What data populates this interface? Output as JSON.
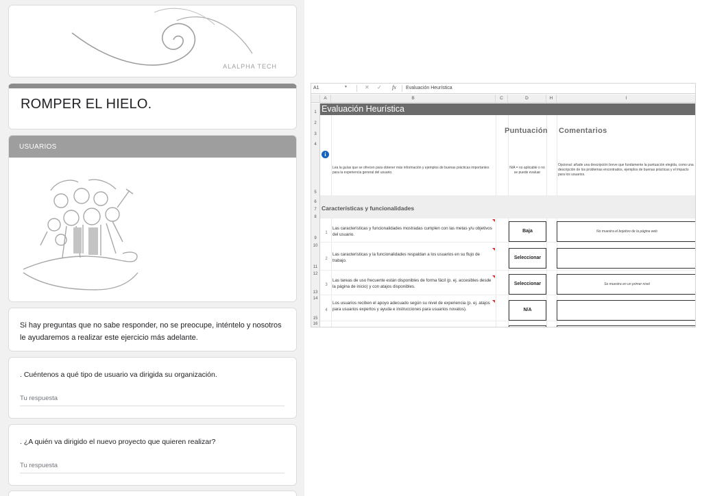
{
  "form": {
    "logo_text": "ALALPHA TECH",
    "title": "ROMPER EL HIELO.",
    "section_title": "USUARIOS",
    "note": "Si hay preguntas que no sabe responder, no se preocupe, inténtelo y nosotros le ayudaremos a realizar este ejercicio más adelante.",
    "questions": [
      {
        "text": ". Cuéntenos a qué tipo de usuario va dirigida su organización.",
        "placeholder": "Tu respuesta"
      },
      {
        "text": ". ¿A quién va dirigido el nuevo proyecto que quieren realizar?",
        "placeholder": "Tu respuesta"
      }
    ]
  },
  "sheet": {
    "name_box": "A1",
    "formula_value": "Evaluación Heurística",
    "fx_label": "fx",
    "columns": [
      "A",
      "B",
      "C",
      "D",
      "H",
      "I"
    ],
    "rows": [
      "1",
      "2",
      "3",
      "4",
      "5",
      "6",
      "7",
      "8",
      "9",
      "10",
      "11",
      "12",
      "13",
      "14",
      "15",
      "16"
    ],
    "title": "Evaluación Heurística",
    "header_score": "Puntuación",
    "header_comments": "Comentarios",
    "instructions": {
      "b": "Lea la guías que se ofrecen para obtener más información y ejemplos de buenas prácticas importantes para la experiencia general del usuario.",
      "d": "N/A = no aplicable o no se puede evaluar",
      "i": "Opcional: añade una descripción breve que fundamente la puntuación elegida, como una descripción de los problemas encontrados, ejemplos de buenas prácticas y el impacto para los usuarios."
    },
    "section": "Características y funcionalidades",
    "criteria": [
      {
        "num": "1",
        "text": "Las características y funcionalidades mostradas cumplen con las metas y/u objetivos del usuario.",
        "score": "Baja",
        "comment": "No muestra el bojetivo de la página web"
      },
      {
        "num": "2",
        "text": "Las características y la funcionalidades respaldan a los usuarios en su flujo de trabajo.",
        "score": "Seleccionar",
        "comment": ""
      },
      {
        "num": "3",
        "text": "Las tareas de uso frecuente están disponibles de forma fácil (p. ej. accesibles desde la página de inicio) y con atajos disponibles.",
        "score": "Seleccionar",
        "comment": "Se muestra en un primer nivel"
      },
      {
        "num": "4",
        "text": "Los usuarios reciben el apoyo adecuado según su nivel de experiencia (p. ej. atajos para usuarios expertos y ayuda e instrucciones para usuarios novatos).",
        "score": "N/A",
        "comment": ""
      }
    ],
    "colors": {
      "title_bar": "#6b6b6b",
      "info_icon": "#1565c0",
      "comment_flag": "#d32f2f"
    }
  }
}
